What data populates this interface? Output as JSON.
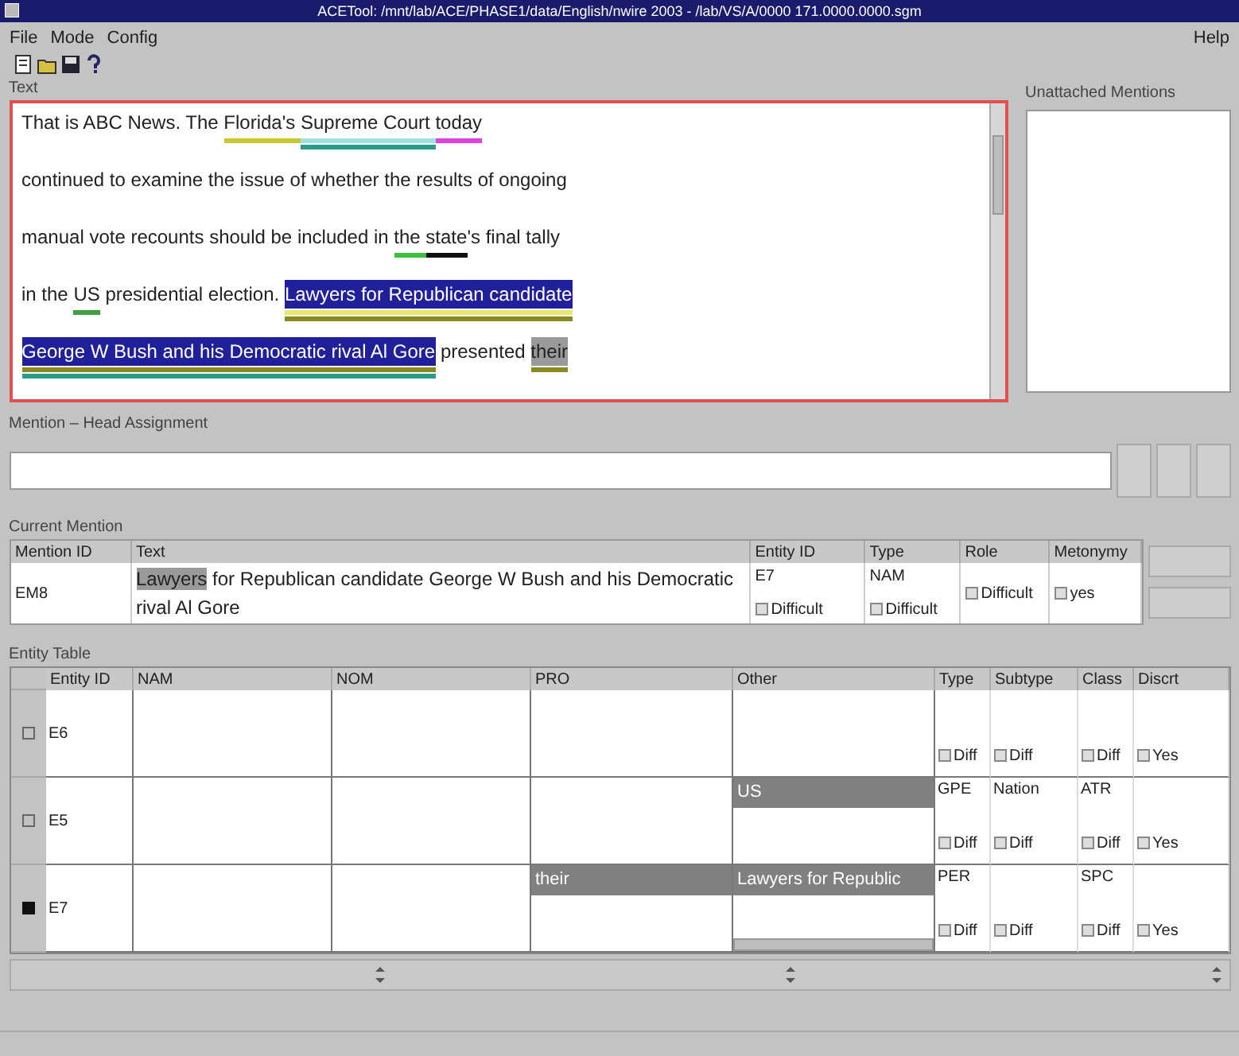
{
  "window": {
    "title": "ACETool: /mnt/lab/ACE/PHASE1/data/English/nwire 2003 - /lab/VS/A/0000 171.0000.0000.sgm"
  },
  "menu": [
    "File",
    "Mode",
    "Config"
  ],
  "help_menu": "Help",
  "toolbar": [
    {
      "kind": "new"
    },
    {
      "kind": "open"
    },
    {
      "kind": "save"
    },
    {
      "kind": "help"
    }
  ],
  "text_panel": {
    "label": "Text",
    "lines": [
      [
        {
          "text": "That is ABC News. The ",
          "kind": "plain"
        },
        {
          "text": "Florida's ",
          "kind": "plain",
          "underlines": [
            {
              "color": "#c8c832"
            }
          ]
        },
        {
          "text": "Supreme Court ",
          "kind": "plain",
          "underlines": [
            {
              "color": "#a0e0e0"
            },
            {
              "color": "#2a9a8a"
            }
          ]
        },
        {
          "text": "today",
          "kind": "plain",
          "underlines": [
            {
              "color": "#e040e0"
            }
          ]
        }
      ],
      [
        {
          "text": "continued to examine the issue of whether the results of ongoing",
          "kind": "plain"
        }
      ],
      [
        {
          "text": "manual vote recounts should be included in ",
          "kind": "plain"
        },
        {
          "text": "the ",
          "kind": "plain",
          "underlines": [
            {
              "color": "#40c040"
            }
          ]
        },
        {
          "text": "state",
          "kind": "plain",
          "underlines": [
            {
              "color": "#101010"
            }
          ]
        },
        {
          "text": "'s final tally",
          "kind": "plain"
        }
      ],
      [
        {
          "text": "in the ",
          "kind": "plain"
        },
        {
          "text": "US",
          "kind": "plain",
          "underlines": [
            {
              "color": "#40a040"
            }
          ]
        },
        {
          "text": " presidential election. ",
          "kind": "plain"
        },
        {
          "text": "Lawyers for Republican candidate",
          "kind": "highlight",
          "underlines": [
            {
              "color": "#e8e870"
            },
            {
              "color": "#8a8a20"
            }
          ]
        }
      ],
      [
        {
          "text": "George W Bush and his Democratic rival Al Gore",
          "kind": "highlight",
          "underlines": [
            {
              "color": "#8a8a20"
            },
            {
              "color": "#2a9a8a"
            }
          ]
        },
        {
          "text": " presented ",
          "kind": "plain"
        },
        {
          "text": "their",
          "kind": "boxed",
          "underlines": [
            {
              "color": "#8a8a20"
            }
          ]
        }
      ]
    ]
  },
  "unattached": {
    "label": "Unattached Mentions"
  },
  "head_assignment": {
    "label": "Mention – Head Assignment"
  },
  "current_mention": {
    "label": "Current Mention",
    "columns": [
      "Mention ID",
      "Text",
      "Entity ID",
      "Type",
      "Role",
      "Metonymy"
    ],
    "row": {
      "mention_id": "EM8",
      "text": [
        {
          "text": "Lawyers",
          "kind": "boxed"
        },
        {
          "text": " for Republican candidate George W Bush and his Democratic rival Al Gore",
          "kind": "plain"
        }
      ],
      "entity_id": "E7",
      "type": "NAM",
      "checks": [
        {
          "label": "Difficult",
          "checked": false
        },
        {
          "label": "Difficult",
          "checked": false
        },
        {
          "label": "Difficult",
          "checked": false
        },
        {
          "label": "yes",
          "checked": false
        }
      ]
    }
  },
  "entity_table": {
    "label": "Entity Table",
    "columns": [
      "Entity ID",
      "NAM",
      "NOM",
      "PRO",
      "Other",
      "Type",
      "Subtype",
      "Class",
      "Discrt"
    ],
    "rows": [
      {
        "selected": false,
        "entity_id": "E6",
        "checks": [
          {
            "label": "Diff",
            "checked": false
          },
          {
            "label": "Diff",
            "checked": false
          },
          {
            "label": "Diff",
            "checked": false
          },
          {
            "label": "Yes",
            "checked": false
          }
        ]
      },
      {
        "selected": false,
        "entity_id": "E5",
        "other": "US",
        "type": "GPE",
        "subtype": "Nation",
        "class": "ATR",
        "checks": [
          {
            "label": "Diff",
            "checked": false
          },
          {
            "label": "Diff",
            "checked": false
          },
          {
            "label": "Diff",
            "checked": false
          },
          {
            "label": "Yes",
            "checked": false
          }
        ]
      },
      {
        "selected": true,
        "entity_id": "E7",
        "pro": "their",
        "other": "Lawyers for Republic",
        "type": "PER",
        "class": "SPC",
        "checks": [
          {
            "label": "Diff",
            "checked": false
          },
          {
            "label": "Diff",
            "checked": false
          },
          {
            "label": "Diff",
            "checked": false
          },
          {
            "label": "Yes",
            "checked": false
          }
        ]
      }
    ]
  }
}
